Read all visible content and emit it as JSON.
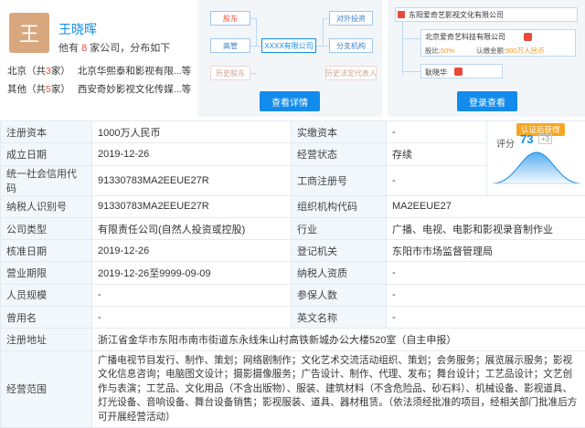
{
  "person": {
    "avatar_char": "王",
    "name": "王晓晖",
    "count_pre": "他有",
    "count_num": "8",
    "count_post": "家公司，分布如下",
    "regions": [
      {
        "city": "北京",
        "num": "3",
        "companies": "北京华熙泰和影视有限...等"
      },
      {
        "city": "其他",
        "num": "5",
        "companies": "西安奇妙影视文化传媒...等"
      }
    ],
    "region_pre": "（共",
    "region_post": "家）"
  },
  "graph": {
    "shareholder": "股东",
    "executive": "高管",
    "history_shareholder": "历史股东",
    "center": "XXXX有限公司",
    "invest": "对外投资",
    "branch": "分支机构",
    "history_legal": "历史法定代表人",
    "button": "查看详情"
  },
  "equity": {
    "top_company": "东阳爱奇艺影视文化有限公司",
    "child_company": "北京爱奇艺科技有限公司",
    "ratio_label": "股比:",
    "ratio_value": "50%",
    "capital_label": "认缴金额:",
    "capital_value": "900万人民币",
    "third_node": "耿晓华",
    "button": "登录查看"
  },
  "score": {
    "badge": "认证后获得",
    "label": "评分",
    "value": "73",
    "plus": "+3"
  },
  "table": {
    "rows": [
      {
        "l1": "注册资本",
        "v1": "1000万人民币",
        "l2": "实缴资本",
        "v2": "-"
      },
      {
        "l1": "成立日期",
        "v1": "2019-12-26",
        "l2": "经营状态",
        "v2": "存续"
      },
      {
        "l1": "统一社会信用代码",
        "v1": "91330783MA2EEUE27R",
        "l2": "工商注册号",
        "v2": "-"
      },
      {
        "l1": "纳税人识别号",
        "v1": "91330783MA2EEUE27R",
        "l2": "组织机构代码",
        "v2": "MA2EEUE27"
      },
      {
        "l1": "公司类型",
        "v1": "有限责任公司(自然人投资或控股)",
        "l2": "行业",
        "v2": "广播、电视、电影和影视录音制作业"
      },
      {
        "l1": "核准日期",
        "v1": "2019-12-26",
        "l2": "登记机关",
        "v2": "东阳市市场监督管理局"
      },
      {
        "l1": "营业期限",
        "v1": "2019-12-26至9999-09-09",
        "l2": "纳税人资质",
        "v2": "-"
      },
      {
        "l1": "人员规模",
        "v1": "-",
        "l2": "参保人数",
        "v2": "-"
      },
      {
        "l1": "曾用名",
        "v1": "-",
        "l2": "英文名称",
        "v2": "-"
      }
    ],
    "address_label": "注册地址",
    "address_value": "浙江省金华市东阳市南市街道东永线朱山村高铁新城办公大楼520室（自主申报）",
    "scope_label": "经营范围",
    "scope_value": "广播电视节目发行、制作、策划；网络剧制作；文化艺术交流活动组织、策划；会务服务；展览展示服务；影视文化信息咨询；电脑图文设计；摄影摄像服务；广告设计、制作、代理、发布；舞台设计；工艺品设计；文艺创作与表演；工艺品、文化用品（不含出版物）、服装、建筑材料（不含危险品、砂石料）、机械设备、影视道具、灯光设备、音响设备、舞台设备销售；影视服装、道具、器材租赁。（依法须经批准的项目，经相关部门批准后方可开展经营活动）"
  },
  "colors": {
    "accent": "#128bed",
    "label_bg": "#f2f7fc",
    "badge": "#f5a623",
    "highlight": "#e84b3c"
  }
}
